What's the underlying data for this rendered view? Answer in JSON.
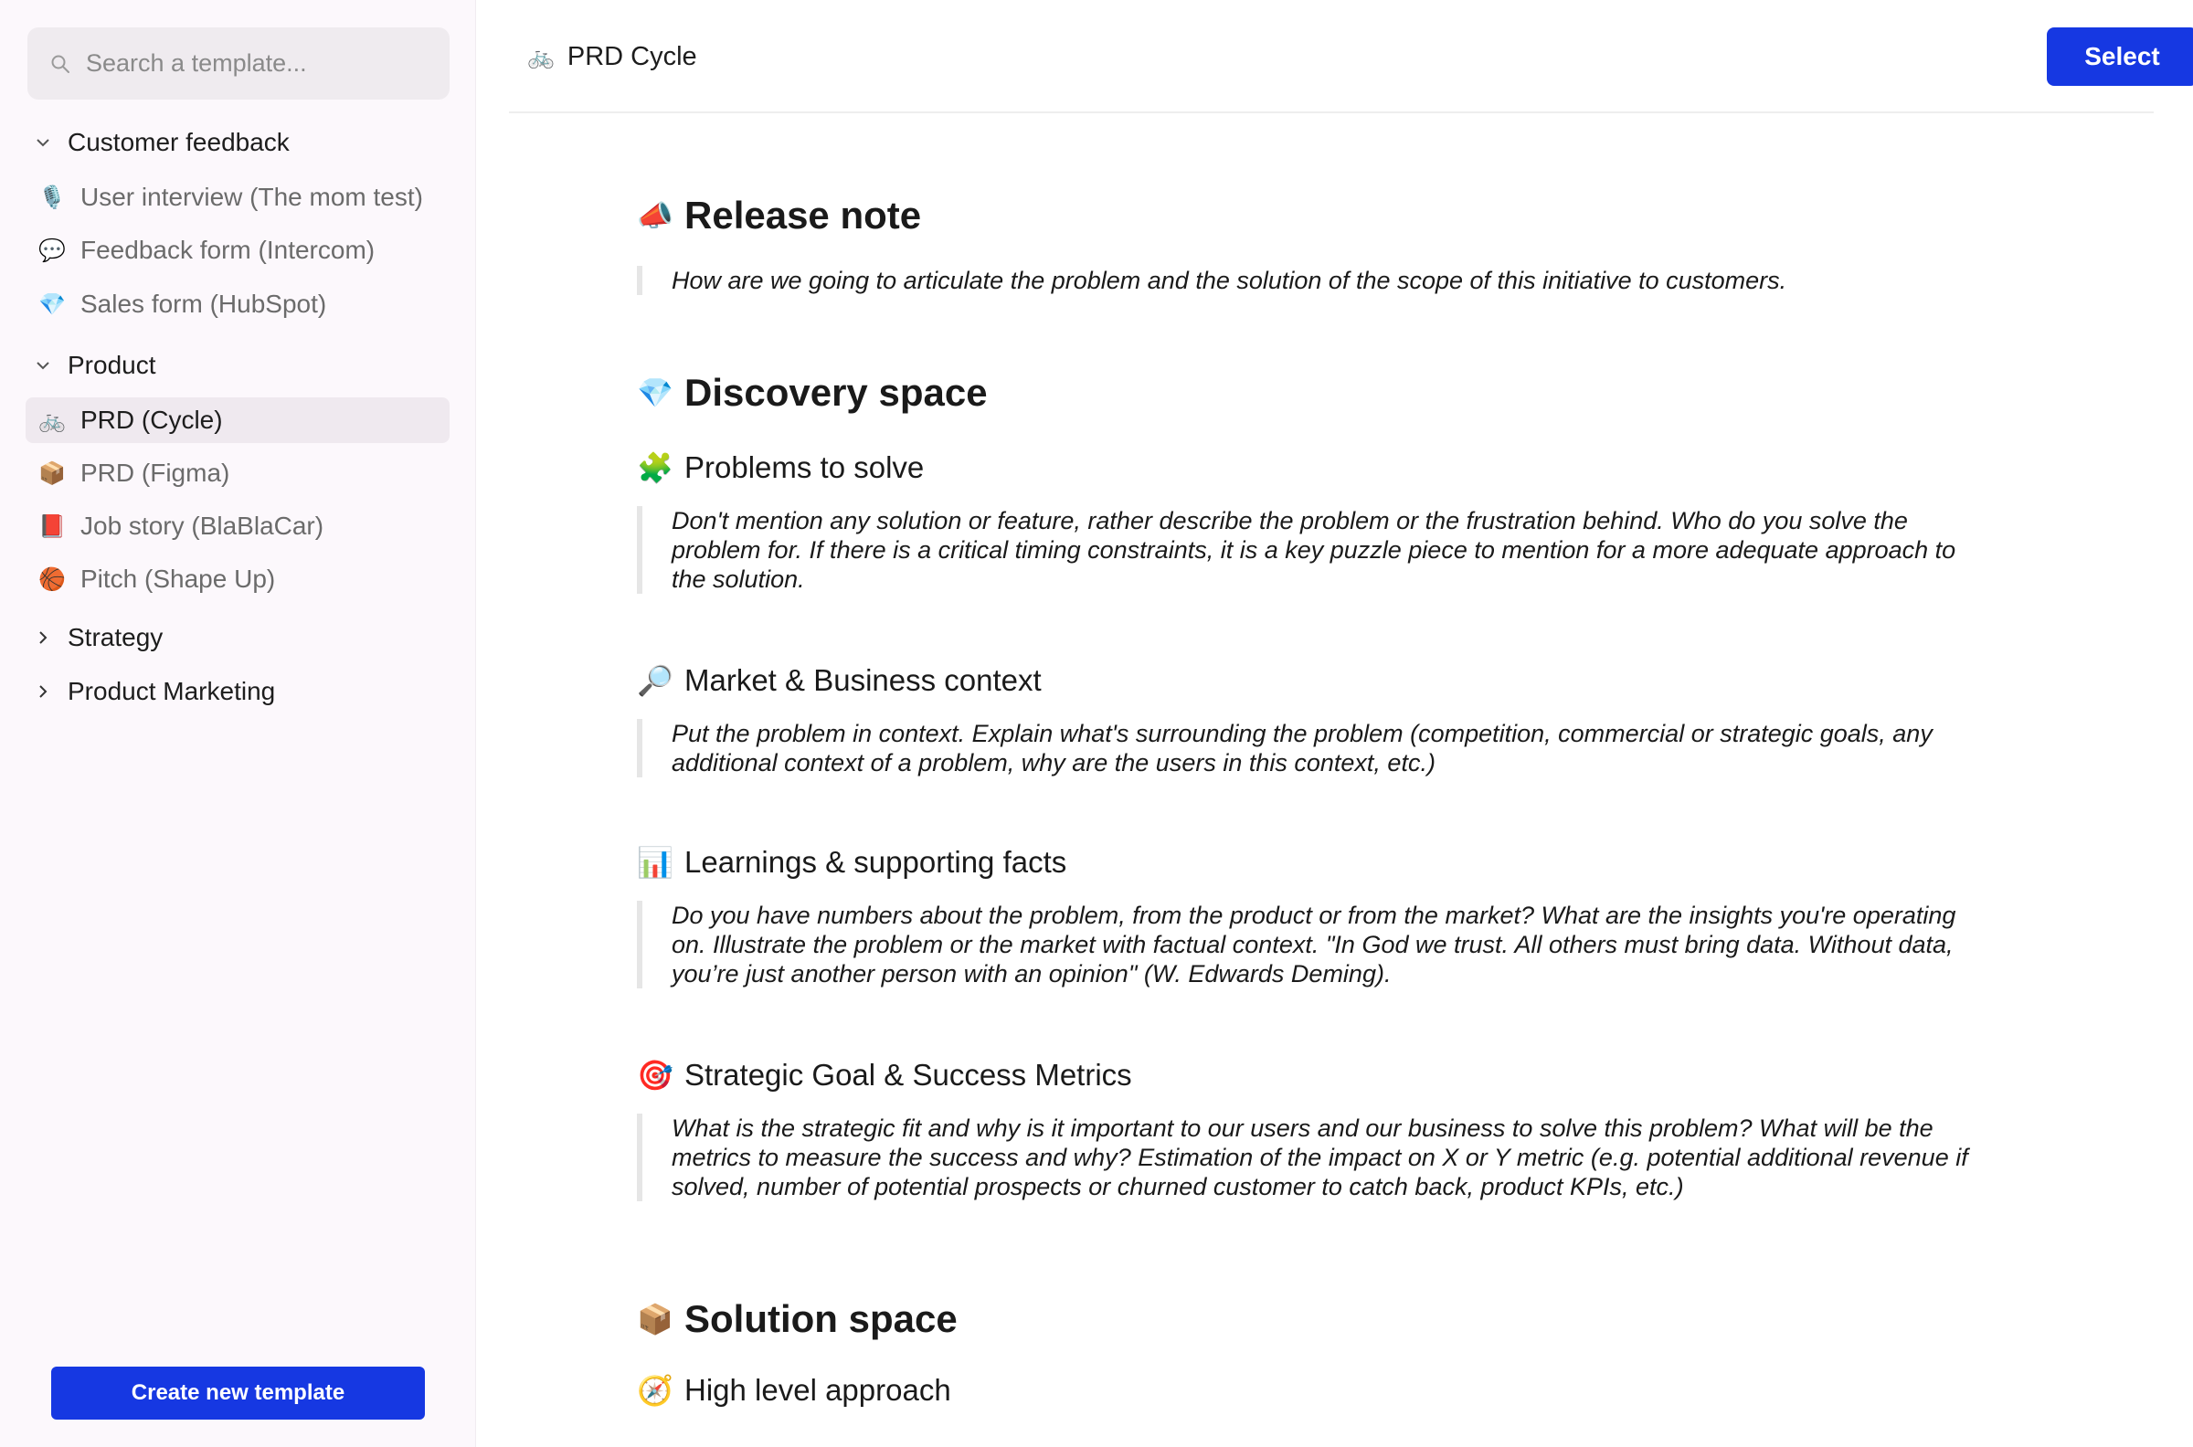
{
  "sidebar": {
    "search_placeholder": "Search a template...",
    "groups": [
      {
        "label": "Customer feedback",
        "expanded": true,
        "items": [
          {
            "icon": "🎙️",
            "label": "User interview (The mom test)"
          },
          {
            "icon": "💬",
            "label": "Feedback form (Intercom)"
          },
          {
            "icon": "💎",
            "label": "Sales form (HubSpot)"
          }
        ]
      },
      {
        "label": "Product",
        "expanded": true,
        "items": [
          {
            "icon": "🚲",
            "label": "PRD (Cycle)",
            "active": true
          },
          {
            "icon": "📦",
            "label": "PRD (Figma)"
          },
          {
            "icon": "📕",
            "label": "Job story (BlaBlaCar)"
          },
          {
            "icon": "🏀",
            "label": "Pitch (Shape Up)"
          }
        ]
      },
      {
        "label": "Strategy",
        "expanded": false
      },
      {
        "label": "Product Marketing",
        "expanded": false
      }
    ],
    "create_button": "Create new template"
  },
  "header": {
    "icon": "🚲",
    "title": "PRD Cycle",
    "select_button": "Select"
  },
  "document": {
    "release_note": {
      "icon": "📣",
      "title": "Release note",
      "text": "How are we going to articulate the problem and the solution of the scope of this initiative to customers."
    },
    "discovery_space": {
      "icon": "💎",
      "title": "Discovery space"
    },
    "problems": {
      "icon": "🧩",
      "title": "Problems to solve",
      "text": "Don't mention any solution or feature, rather describe the problem or the frustration behind. Who do you solve the problem for. If there is a critical timing constraints, it is a key puzzle piece to mention for a more adequate approach to the solution."
    },
    "market": {
      "icon": "🔎",
      "title": "Market & Business context",
      "text": "Put the problem in context. Explain what's surrounding the problem (competition, commercial or strategic goals, any additional context of a problem, why are the users in this context, etc.)"
    },
    "learnings": {
      "icon": "📊",
      "title": "Learnings & supporting facts",
      "text": "Do you have numbers about the problem, from the product or from the market? What are the insights you're operating on. Illustrate the problem or the market with factual context. \"In God we trust. All others must bring data. Without data, you’re just another person with an opinion\" (W. Edwards Deming)."
    },
    "strategic": {
      "icon": "🎯",
      "title": "Strategic Goal & Success Metrics",
      "text": "What is the strategic fit and why is it important to our users and our business to solve this problem? What will be the metrics to measure the success and why? Estimation of the impact on X or Y metric (e.g. potential additional revenue if solved, number of potential prospects or churned customer to catch back, product KPIs, etc.)"
    },
    "solution_space": {
      "icon": "📦",
      "title": "Solution space"
    },
    "approach": {
      "icon": "🧭",
      "title": "High level approach"
    }
  }
}
